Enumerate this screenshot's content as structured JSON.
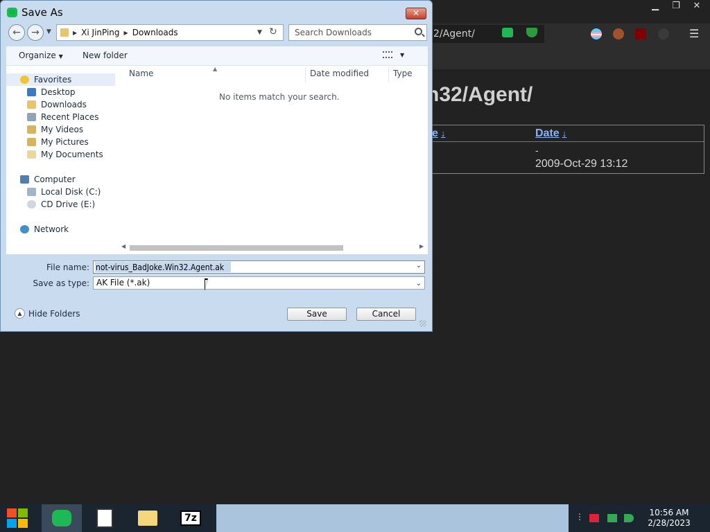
{
  "browser": {
    "url_fragment": "2/Agent/",
    "heading": "n32/Agent/",
    "col_name_partial": "e",
    "col_date": "Date",
    "sort_indicator": "↓",
    "row_dash": "-",
    "row_date": "2009-Oct-29 13:12",
    "window_controls": [
      "▁",
      "❐",
      "✕"
    ]
  },
  "dialog": {
    "title": "Save As",
    "close_glyph": "✕",
    "breadcrumb": [
      "Xi JinPing",
      "Downloads"
    ],
    "search_placeholder": "Search Downloads",
    "toolbar": {
      "organize": "Organize",
      "new_folder": "New folder"
    },
    "nav": {
      "favorites": "Favorites",
      "favorite_items": [
        "Desktop",
        "Downloads",
        "Recent Places",
        "My Videos",
        "My Pictures",
        "My Documents"
      ],
      "computer": "Computer",
      "computer_items": [
        "Local Disk (C:)",
        "CD Drive (E:)"
      ],
      "network": "Network"
    },
    "columns": {
      "name": "Name",
      "date_modified": "Date modified",
      "type": "Type"
    },
    "empty_message": "No items match your search.",
    "file_name_label": "File name:",
    "file_name_value": "not-virus_BadJoke.Win32.Agent.ak",
    "save_as_type_label": "Save as type:",
    "save_as_type_value": "AK File (*.ak)",
    "hide_folders": "Hide Folders",
    "save_button": "Save",
    "cancel_button": "Cancel"
  },
  "taskbar": {
    "time": "10:56 AM",
    "date": "2/28/2023",
    "apps": [
      "spotify-like",
      "notepad-doc",
      "file-explorer",
      "7zip"
    ],
    "sevenzip_label": "7z"
  },
  "colors": {
    "dialog_frame": "#c9dcef",
    "link_blue": "#8ab4f8",
    "taskbar": "#1b2530",
    "accent_green": "#1db954"
  }
}
